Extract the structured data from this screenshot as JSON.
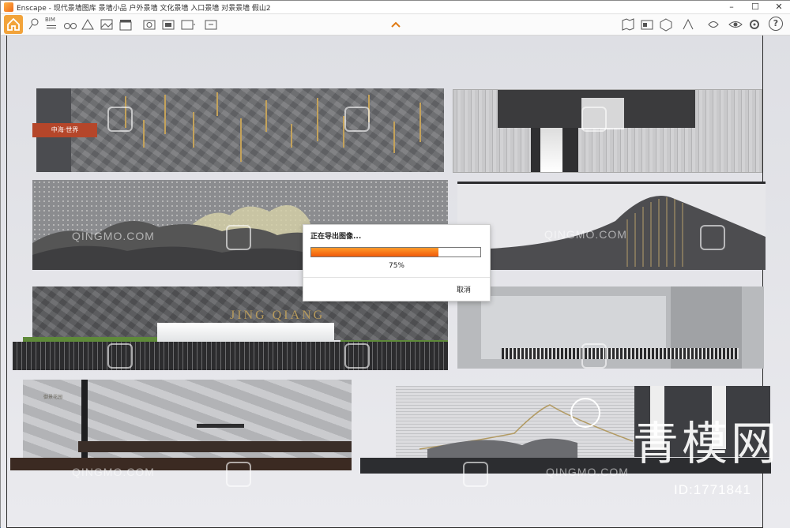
{
  "window": {
    "title": "Enscape - 现代景墙图库 景墙小品 户外景墙 文化景墙 入口景墙 对景景墙 假山2",
    "minimize": "–",
    "maximize": "☐",
    "close": "✕"
  },
  "toolbar": {
    "left_icons": [
      "home-icon",
      "location-pin-icon",
      "bim-icon",
      "binoculars-icon",
      "scene-icon",
      "landscape-icon",
      "clapperboard-icon",
      "screenshot-icon",
      "batch-render-icon",
      "export-360-icon",
      "export-exe-icon"
    ],
    "right_icons": [
      "map-icon",
      "asset-library-icon",
      "cube-icon",
      "material-editor-icon",
      "atmosphere-icon",
      "visibility-icon",
      "settings-icon",
      "help-icon"
    ],
    "collapse_glyph": "^",
    "help_glyph": "?",
    "bim_label": "BIM"
  },
  "scene": {
    "sign_text": "中海·世界",
    "jing_qiang_text": "JING QIANG",
    "small_sign_text": "御景花园"
  },
  "watermarks": {
    "url": "QINGMO.COM",
    "brand": "青模网",
    "id": "ID:1771841"
  },
  "export_dialog": {
    "title": "正在导出图像...",
    "progress_percent": 75,
    "progress_label": "75%",
    "cancel_label": "取消"
  },
  "colors": {
    "accent": "#f2a33a",
    "progress": "#f05a0a"
  }
}
